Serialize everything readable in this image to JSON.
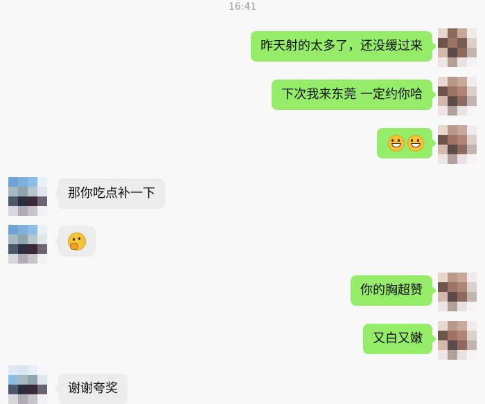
{
  "timestamp": "16:41",
  "messages": [
    {
      "text": "昨天射的太多了，还没缓过来"
    },
    {
      "text": "下次我来东莞  一定约你哈"
    },
    {
      "emoji": "grinning-face-with-teeth-icon"
    },
    {
      "text": "那你吃点补一下"
    },
    {
      "emoji": "thinking-face-icon"
    },
    {
      "text": "你的胸超赞"
    },
    {
      "text": "又白又嫩"
    },
    {
      "text": "谢谢夸奖"
    }
  ],
  "colors": {
    "outgoing_bubble": "#95ec69",
    "incoming_bubble": "#ececec",
    "background": "#f8f8f8"
  }
}
